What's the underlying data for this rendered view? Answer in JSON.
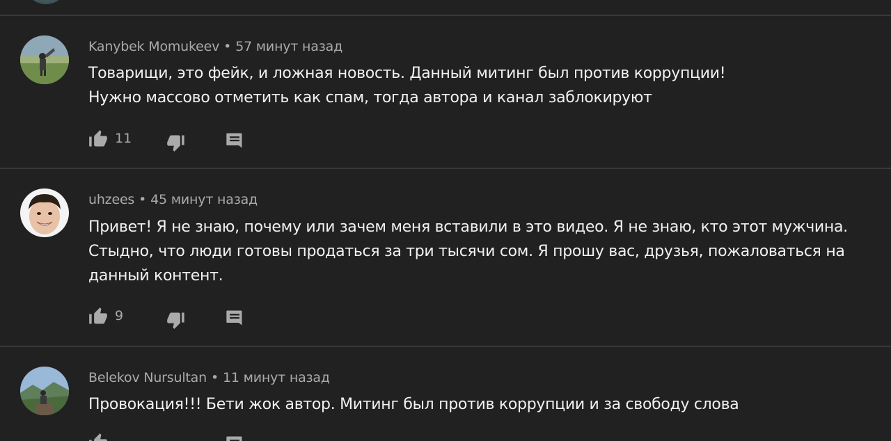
{
  "comments": [
    {
      "author": "Kanybek Momukeev",
      "separator": "•",
      "time": "57 минут назад",
      "lines": [
        "Товарищи, это фейк, и ложная новость. Данный митинг был против коррупции!",
        "Нужно массово отметить как спам, тогда автора и канал заблокируют"
      ],
      "likes": "11",
      "icons": {
        "like": "thumbs-up-icon",
        "dislike": "thumbs-down-icon",
        "reply": "reply-icon"
      }
    },
    {
      "author": "uhzees",
      "separator": "•",
      "time": "45 минут назад",
      "lines": [
        "Привет! Я не знаю, почему или зачем меня вставили в это видео. Я не знаю, кто этот мужчина.",
        "Стыдно, что люди готовы продаться за три тысячи сом. Я прошу вас, друзья, пожаловаться на",
        "данный контент."
      ],
      "likes": "9",
      "icons": {
        "like": "thumbs-up-icon",
        "dislike": "thumbs-down-icon",
        "reply": "reply-icon"
      }
    },
    {
      "author": "Belekov Nursultan",
      "separator": "•",
      "time": "11 минут назад",
      "lines": [
        "Провокация!!! Бети жок автор. Митинг был против коррупции и за свободу слова"
      ],
      "likes": "",
      "icons": {
        "like": "thumbs-up-icon",
        "dislike": "thumbs-down-icon",
        "reply": "reply-icon"
      }
    }
  ],
  "colors": {
    "background": "#212121",
    "divider": "#383838",
    "text_primary": "#f1f1f1",
    "text_secondary": "#aaaaaa",
    "icon": "#aaaaaa"
  }
}
